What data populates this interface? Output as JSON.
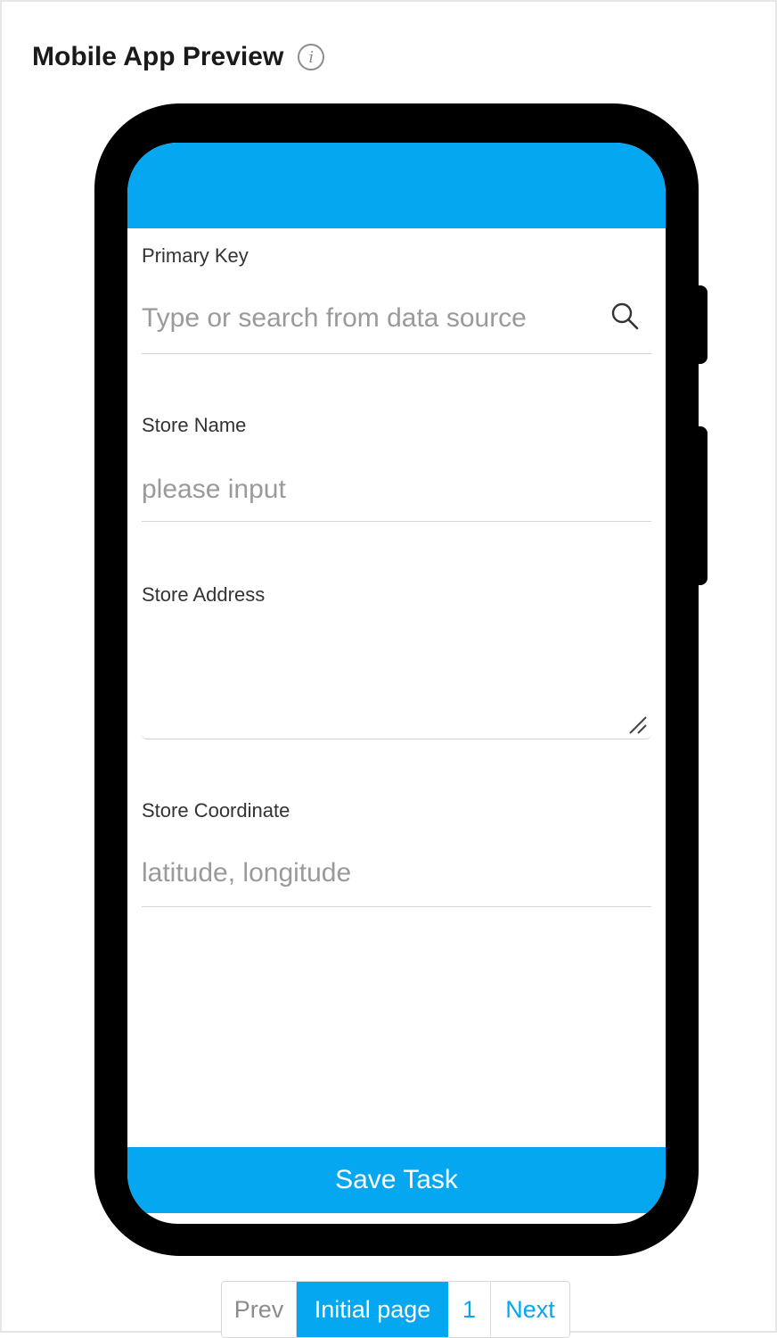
{
  "header": {
    "title": "Mobile App Preview"
  },
  "form": {
    "primary_key": {
      "label": "Primary Key",
      "placeholder": "Type or search from data source"
    },
    "store_name": {
      "label": "Store Name",
      "placeholder": "please input"
    },
    "store_address": {
      "label": "Store Address",
      "placeholder": ""
    },
    "store_coordinate": {
      "label": "Store Coordinate",
      "placeholder": "latitude, longitude"
    },
    "save_label": "Save Task"
  },
  "pagination": {
    "prev": "Prev",
    "current": "Initial page",
    "page": "1",
    "next": "Next"
  },
  "colors": {
    "accent": "#04a7f0",
    "frame": "#000000"
  }
}
